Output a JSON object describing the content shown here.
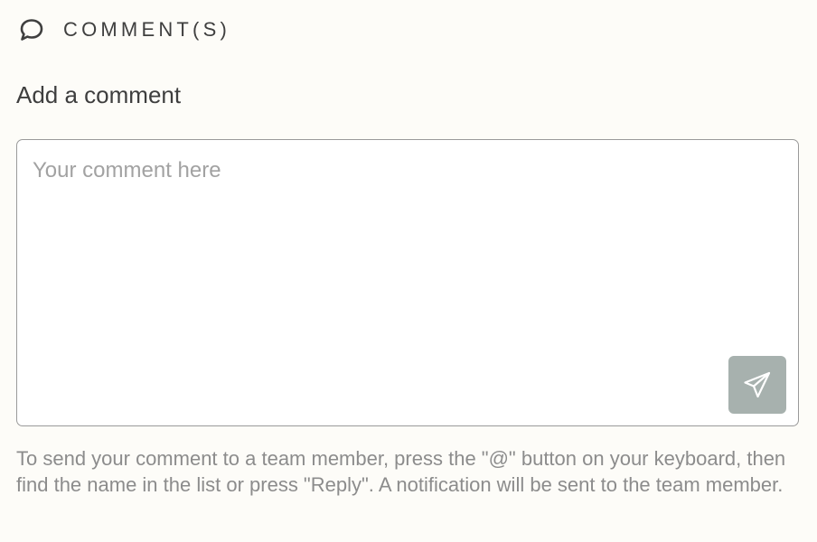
{
  "section": {
    "icon": "comment-bubble-icon",
    "title": "COMMENT(S)"
  },
  "form": {
    "label": "Add a comment",
    "input": {
      "placeholder": "Your comment here",
      "value": ""
    },
    "send_button": {
      "icon": "send-paper-plane-icon",
      "background_color": "#a7b1ae"
    },
    "help_text": "To send your comment to a team member, press the \"@\" button on your keyboard, then find the name in the list or press \"Reply\". A notification will be sent to the team member."
  },
  "colors": {
    "page_background": "#fdfcf8",
    "border": "#9a9a9a",
    "text_primary": "#3e3e3e",
    "text_muted": "#8c8c8c"
  }
}
